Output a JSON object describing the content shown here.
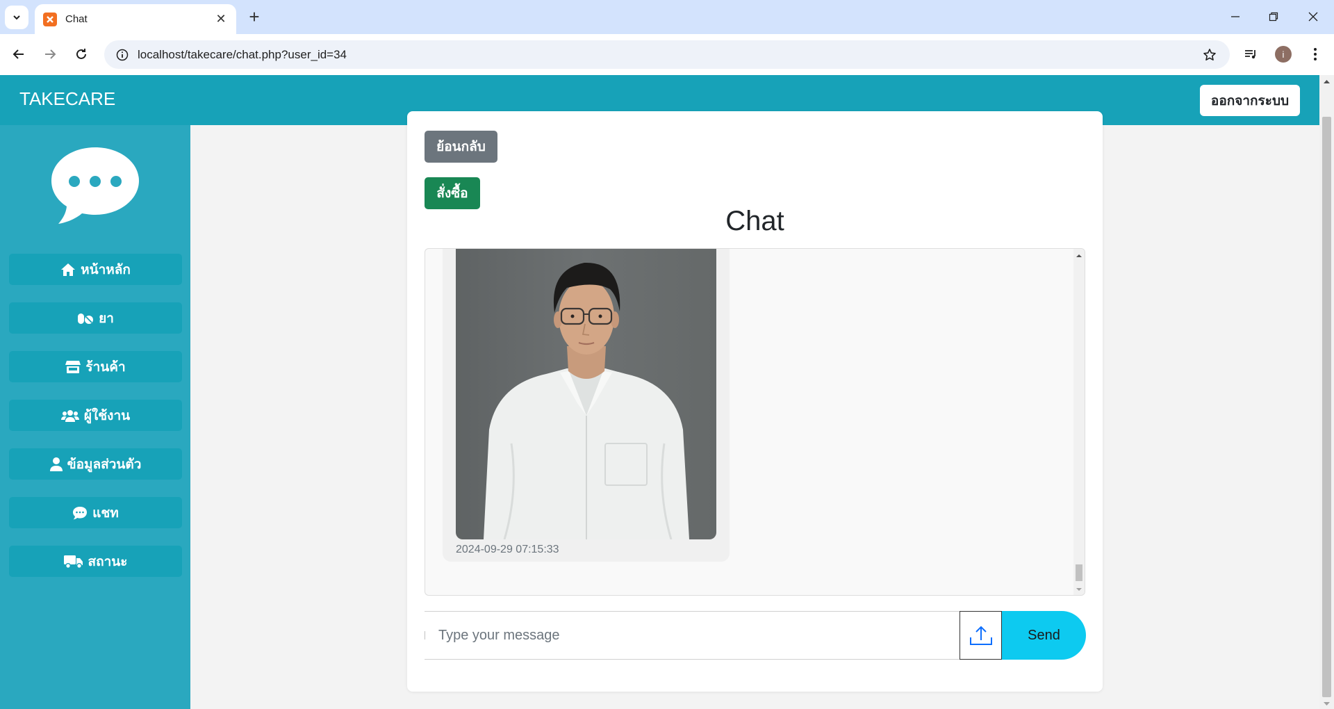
{
  "browser": {
    "tab_title": "Chat",
    "url": "localhost/takecare/chat.php?user_id=34",
    "profile_initial": "i"
  },
  "app": {
    "brand": "TAKECARE",
    "logout_label": "ออกจากระบบ",
    "accent": "#17a2b8"
  },
  "sidebar": {
    "items": [
      {
        "label": "หน้าหลัก",
        "icon": "home-icon"
      },
      {
        "label": "ยา",
        "icon": "pills-icon"
      },
      {
        "label": "ร้านค้า",
        "icon": "store-icon"
      },
      {
        "label": "ผู้ใช้งาน",
        "icon": "users-icon"
      },
      {
        "label": "ข้อมูลส่วนตัว",
        "icon": "user-icon"
      },
      {
        "label": "แชท",
        "icon": "chat-icon"
      },
      {
        "label": "สถานะ",
        "icon": "truck-icon"
      }
    ]
  },
  "chat": {
    "back_label": "ย้อนกลับ",
    "order_label": "สั่งซื้อ",
    "title": "Chat",
    "messages": [
      {
        "type": "image",
        "timestamp": "2024-09-29 07:15:33"
      }
    ],
    "input_placeholder": "Type your message",
    "send_label": "Send"
  }
}
